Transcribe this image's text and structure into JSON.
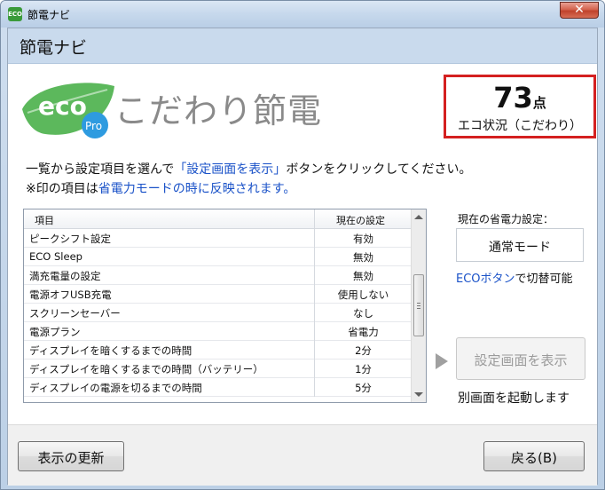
{
  "window": {
    "title": "節電ナビ",
    "close_glyph": "✕",
    "app_icon_text": "ECO"
  },
  "header": {
    "title": "節電ナビ"
  },
  "logo": {
    "eco_text": "eco",
    "pro_text": "Pro",
    "product_name": "こだわり節電",
    "leaf_color": "#5cb85c",
    "badge_color": "#2e9be0"
  },
  "score": {
    "value": "73",
    "unit": "点",
    "caption": "エコ状況（こだわり）",
    "border_color": "#d42020"
  },
  "instructions": {
    "line1_pre": "一覧から設定項目を選んで",
    "line1_link": "「設定画面を表示」",
    "line1_post": "ボタンをクリックしてください。",
    "line2_pre": "※印の項目は",
    "line2_link": "省電力モードの時に反映されます。"
  },
  "settings_list": {
    "columns": [
      "項目",
      "現在の設定"
    ],
    "rows": [
      {
        "item": "ピークシフト設定",
        "value": "有効"
      },
      {
        "item": "ECO Sleep",
        "value": "無効"
      },
      {
        "item": "満充電量の設定",
        "value": "無効"
      },
      {
        "item": "電源オフUSB充電",
        "value": "使用しない"
      },
      {
        "item": "スクリーンセーバー",
        "value": "なし"
      },
      {
        "item": "電源プラン",
        "value": "省電力"
      },
      {
        "item": "ディスプレイを暗くするまでの時間",
        "value": "2分"
      },
      {
        "item": "ディスプレイを暗くするまでの時間（バッテリー）",
        "value": "1分"
      },
      {
        "item": "ディスプレイの電源を切るまでの時間",
        "value": "5分"
      }
    ]
  },
  "power_mode": {
    "label": "現在の省電力設定：",
    "value": "通常モード",
    "hint_link": "ECOボタン",
    "hint_post": "で切替可能"
  },
  "show_settings": {
    "label": "設定画面を表示",
    "hint": "別画面を起動します"
  },
  "footer": {
    "refresh_label": "表示の更新",
    "back_label": "戻る(B)"
  },
  "colors": {
    "link": "#1a52c8",
    "header_band": "#c9daed"
  }
}
